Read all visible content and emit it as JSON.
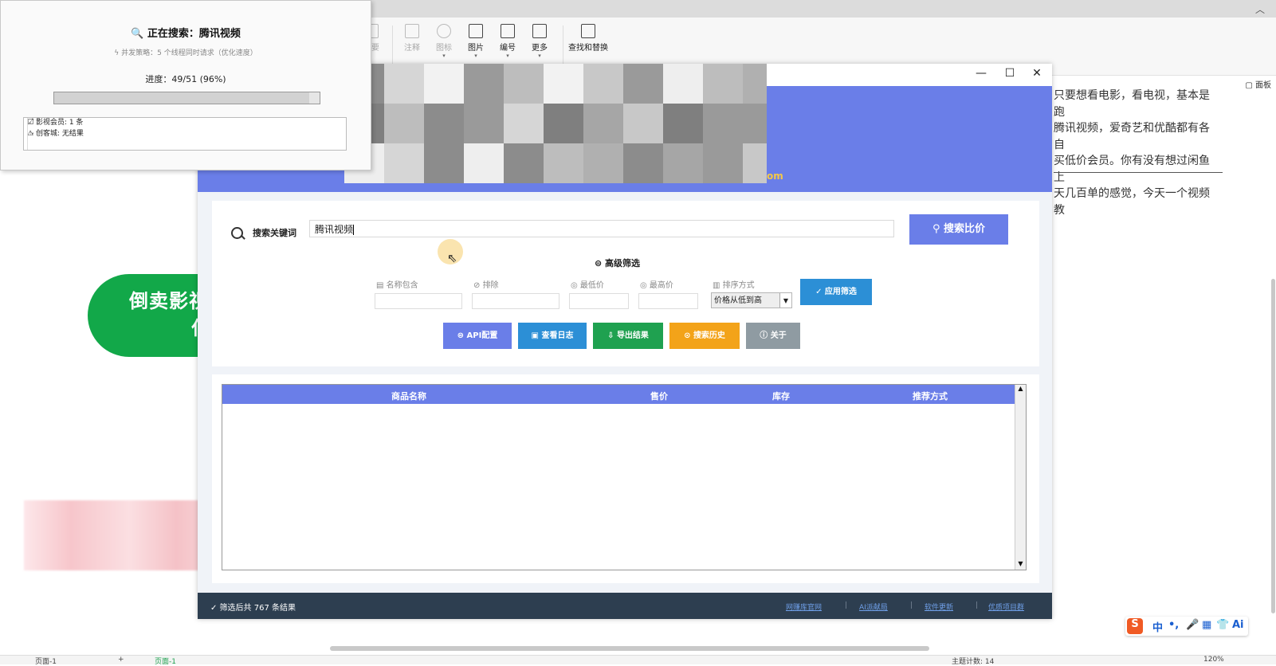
{
  "ribbon": {
    "tools": [
      {
        "label": "摘要",
        "icon": "summary-icon"
      },
      {
        "label": "注释",
        "icon": "annotation-icon"
      },
      {
        "label": "图标",
        "icon": "icon-library-icon"
      },
      {
        "label": "图片",
        "icon": "image-icon"
      },
      {
        "label": "编号",
        "icon": "numbering-icon"
      },
      {
        "label": "更多",
        "icon": "more-icon"
      },
      {
        "label": "查找和替换",
        "icon": "find-replace-icon"
      }
    ],
    "panel_label": "面板"
  },
  "document": {
    "lines": [
      "只要想看电影，看电视，基本是跑",
      "腾讯视频，爱奇艺和优酷都有各自",
      "买低价会员。你有没有想过闲鱼上",
      "天几百单的感觉，今天一个视频教"
    ],
    "banner_line1": "倒卖影视",
    "banner_line2": "仆"
  },
  "dialog": {
    "title": "正在搜索：腾讯视频",
    "subtitle": "并发策略：5 个线程同时请求（优化速度）",
    "progress_text": "进度：49/51 (96%)",
    "progress_fraction": 0.96,
    "log": [
      "影视会员: 1 条",
      "创客城: 无结果"
    ]
  },
  "app": {
    "domain_fragment": "om",
    "search": {
      "label": "搜索关键词",
      "value": "腾讯视频",
      "button": "搜索比价"
    },
    "filters": {
      "title": "高级筛选",
      "name_contains": "名称包含",
      "exclude": "排除",
      "min_price": "最低价",
      "max_price": "最高价",
      "sort_by": "排序方式",
      "sort_value": "价格从低到高",
      "apply": "✓ 应用筛选"
    },
    "actions": [
      {
        "label": "API配置",
        "color": "#6a7ee8"
      },
      {
        "label": "查看日志",
        "color": "#2c8fd6"
      },
      {
        "label": "导出结果",
        "color": "#1fa150"
      },
      {
        "label": "搜索历史",
        "color": "#f3a319"
      },
      {
        "label": "关于",
        "color": "#8f9ba2"
      }
    ],
    "table": {
      "columns": [
        "商品名称",
        "售价",
        "库存",
        "推荐方式"
      ]
    },
    "footer": {
      "result_text": "✓ 筛选后共 767 条结果",
      "links": [
        "网赚库官网",
        "AI派献局",
        "软件更新",
        "优质项目群"
      ]
    }
  },
  "statusbar": {
    "page": "页面-1",
    "page_tab": "页面-1",
    "word_count": "主题计数: 14",
    "zoom": "120%"
  }
}
